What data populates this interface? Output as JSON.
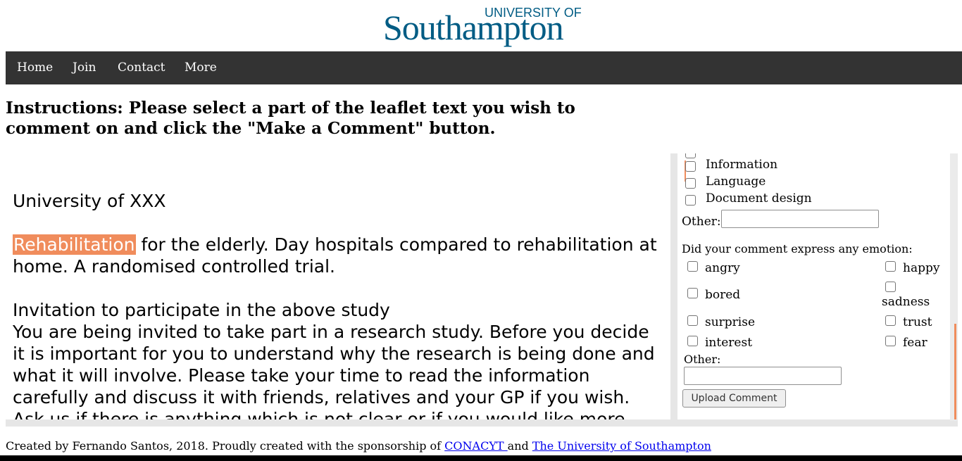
{
  "logo": {
    "top_line": "UNIVERSITY OF",
    "main": "Southampton"
  },
  "nav": {
    "items": [
      "Home",
      "Join",
      "Contact",
      "More"
    ]
  },
  "instructions": "Instructions: Please select a part of the leaflet text you wish to comment on and click the \"Make a Comment\" button.",
  "leaflet": {
    "heading": "University of XXX",
    "highlight": "Rehabilitation",
    "title_rest": " for the elderly. Day hospitals compared to rehabilitation at home. A randomised controlled trial.",
    "invitation_heading": "Invitation to participate in the above study",
    "body": "You are being invited to take part in a research study. Before you decide it is important for you to understand why the research is being done and what it will involve. Please take your time to read the information carefully and discuss it with friends, relatives and your GP if you wish. Ask us if there is anything which is not clear or if you would like more information."
  },
  "panel": {
    "categories": [
      "Information",
      "Language",
      "Document design"
    ],
    "other_label": "Other:",
    "emotion_question": "Did your comment express any emotion:",
    "emotions_left": [
      "angry",
      "bored",
      "surprise",
      "interest"
    ],
    "emotions_right": [
      "happy",
      "sadness",
      "trust",
      "fear"
    ],
    "other_label_2": "Other:",
    "upload_button": "Upload Comment"
  },
  "footer": {
    "prefix": "Created by Fernando Santos, 2018. Proudly created with the sponsorship of ",
    "link1": "CONACYT ",
    "middle": " and ",
    "link2": "The University of Southampton "
  },
  "colors": {
    "highlight": "#f08c5c",
    "nav_bg": "#333333",
    "brand": "#005c84"
  }
}
